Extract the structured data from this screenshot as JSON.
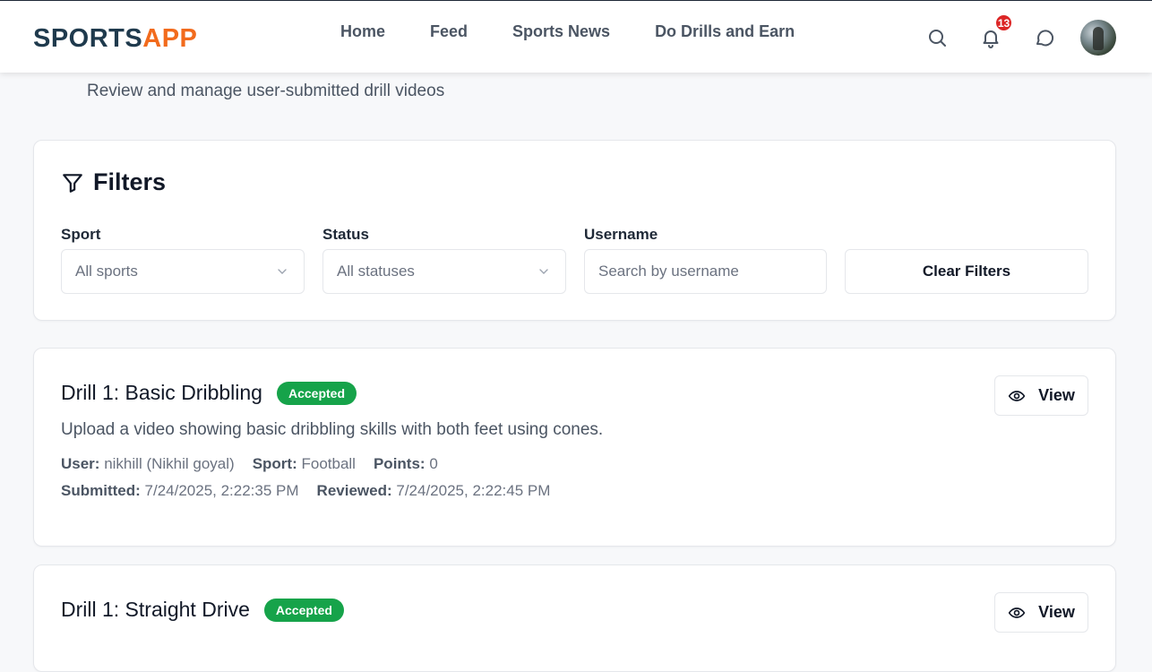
{
  "brand": {
    "part1": "SPORTS",
    "part2": "APP"
  },
  "nav": {
    "links": [
      "Home",
      "Feed",
      "Sports News",
      "Do Drills and Earn"
    ],
    "notification_count": "13"
  },
  "page": {
    "subtitle": "Review and manage user-submitted drill videos"
  },
  "filters": {
    "title": "Filters",
    "sport_label": "Sport",
    "sport_value": "All sports",
    "status_label": "Status",
    "status_value": "All statuses",
    "username_label": "Username",
    "username_placeholder": "Search by username",
    "clear_label": "Clear Filters"
  },
  "drills": [
    {
      "title": "Drill 1: Basic Dribbling",
      "status": "Accepted",
      "view_label": "View",
      "description": "Upload a video showing basic dribbling skills with both feet using cones.",
      "user_label": "User:",
      "user_value": "nikhill (Nikhil goyal)",
      "sport_label": "Sport:",
      "sport_value": "Football",
      "points_label": "Points:",
      "points_value": "0",
      "submitted_label": "Submitted:",
      "submitted_value": "7/24/2025, 2:22:35 PM",
      "reviewed_label": "Reviewed:",
      "reviewed_value": "7/24/2025, 2:22:45 PM"
    },
    {
      "title": "Drill 1: Straight Drive",
      "status": "Accepted",
      "view_label": "View"
    }
  ],
  "colors": {
    "accent_orange": "#f26b1d",
    "brand_navy": "#1f3a4d",
    "accepted_green": "#16a34a",
    "badge_red": "#dc2626"
  }
}
